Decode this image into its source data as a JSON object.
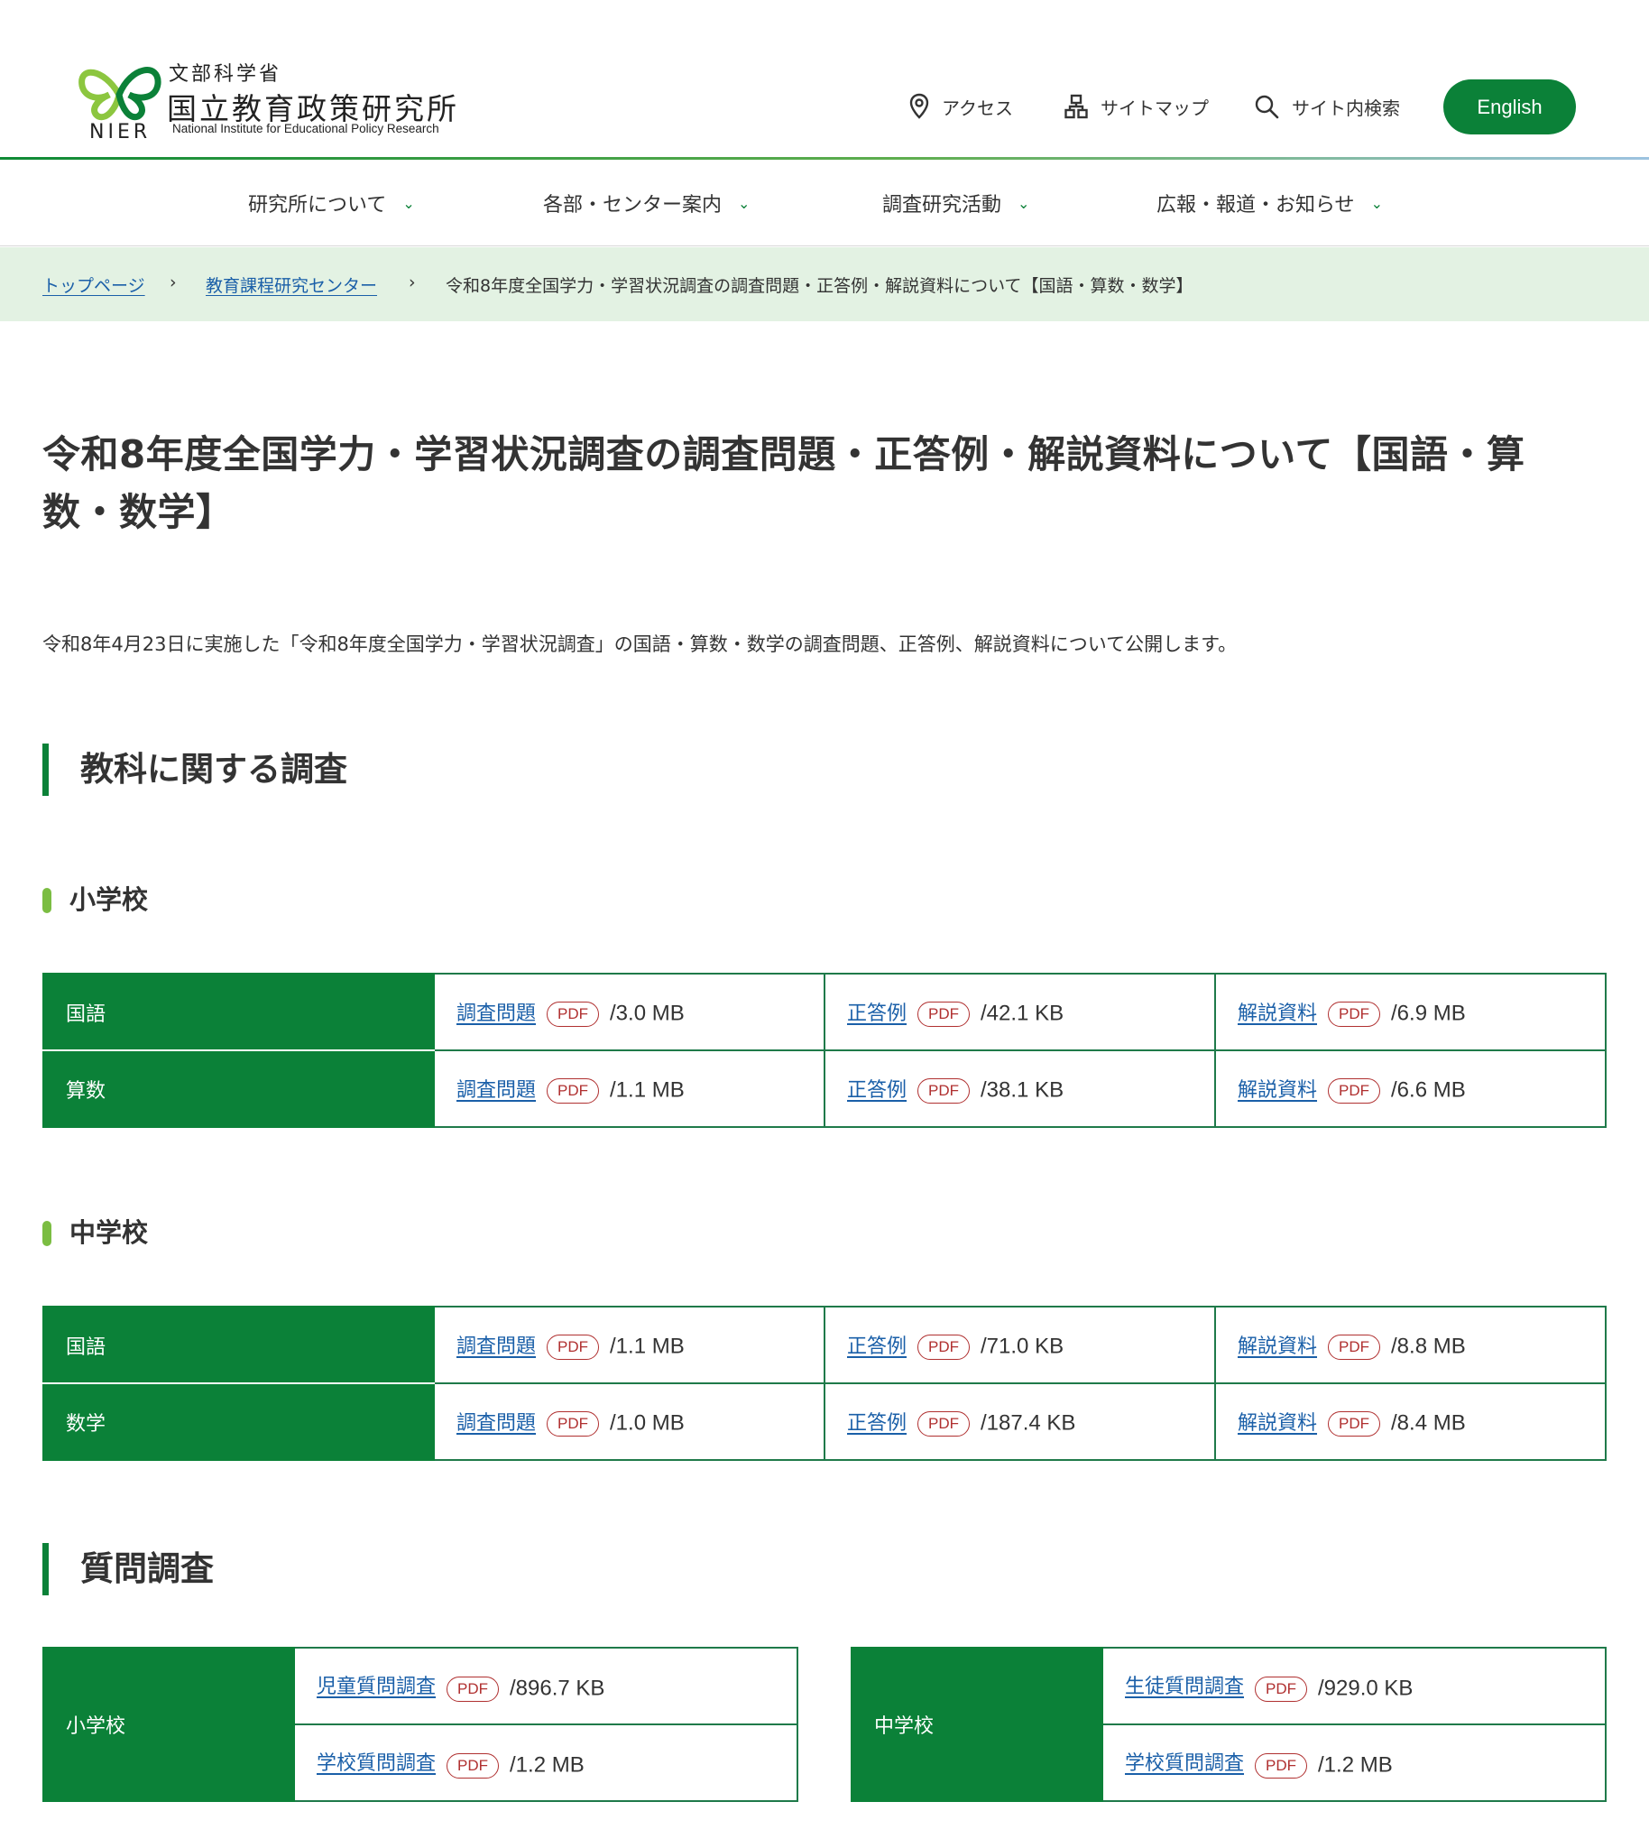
{
  "header": {
    "logo": {
      "ministry": "文部科学省",
      "name": "国立教育政策研究所",
      "abbr": "NIER",
      "english_name": "National Institute for Educational Policy Research"
    },
    "utility_links": {
      "access": "アクセス",
      "sitemap": "サイトマップ",
      "search": "サイト内検索"
    },
    "english_button": "English",
    "colors": {
      "brand_green": "#0b8138",
      "link_blue": "#1a5fa8",
      "accent_lime": "#7bbd42"
    }
  },
  "nav": {
    "items": [
      "研究所について",
      "各部・センター案内",
      "調査研究活動",
      "広報・報道・お知らせ"
    ]
  },
  "breadcrumb": {
    "items": [
      {
        "label": "トップページ",
        "link": true
      },
      {
        "label": "教育課程研究センター",
        "link": true
      },
      {
        "label": "令和8年度全国学力・学習状況調査の調査問題・正答例・解説資料について【国語・算数・数学】",
        "link": false
      }
    ],
    "separator": "›"
  },
  "main": {
    "title_line1": "令和8年度全国学力・学習状況調査の調査問題・正答例・解説資料について【国語・算",
    "title_line2": "数・数学】",
    "lead": "令和8年4月23日に実施した「令和8年度全国学力・学習状況調査」の国語・算数・数学の調査問題、正答例、解説資料について公開します。",
    "section_subject": {
      "heading": "教科に関する調査",
      "pdf_badge": "PDF",
      "elementary": {
        "heading": "小学校",
        "rows": [
          {
            "subject": "国語",
            "docs": [
              {
                "label": "調査問題",
                "size": "/3.0 MB"
              },
              {
                "label": "正答例",
                "size": "/42.1 KB"
              },
              {
                "label": "解説資料",
                "size": "/6.9 MB"
              }
            ]
          },
          {
            "subject": "算数",
            "docs": [
              {
                "label": "調査問題",
                "size": "/1.1 MB"
              },
              {
                "label": "正答例",
                "size": "/38.1 KB"
              },
              {
                "label": "解説資料",
                "size": "/6.6 MB"
              }
            ]
          }
        ]
      },
      "junior_high": {
        "heading": "中学校",
        "rows": [
          {
            "subject": "国語",
            "docs": [
              {
                "label": "調査問題",
                "size": "/1.1 MB"
              },
              {
                "label": "正答例",
                "size": "/71.0 KB"
              },
              {
                "label": "解説資料",
                "size": "/8.8 MB"
              }
            ]
          },
          {
            "subject": "数学",
            "docs": [
              {
                "label": "調査問題",
                "size": "/1.0 MB"
              },
              {
                "label": "正答例",
                "size": "/187.4 KB"
              },
              {
                "label": "解説資料",
                "size": "/8.4 MB"
              }
            ]
          }
        ]
      }
    },
    "section_questionnaire": {
      "heading": "質問調査",
      "elementary": {
        "label": "小学校",
        "docs": [
          {
            "label": "児童質問調査",
            "size": "/896.7 KB"
          },
          {
            "label": "学校質問調査",
            "size": "/1.2 MB"
          }
        ]
      },
      "junior_high": {
        "label": "中学校",
        "docs": [
          {
            "label": "生徒質問調査",
            "size": "/929.0 KB"
          },
          {
            "label": "学校質問調査",
            "size": "/1.2 MB"
          }
        ]
      }
    }
  }
}
